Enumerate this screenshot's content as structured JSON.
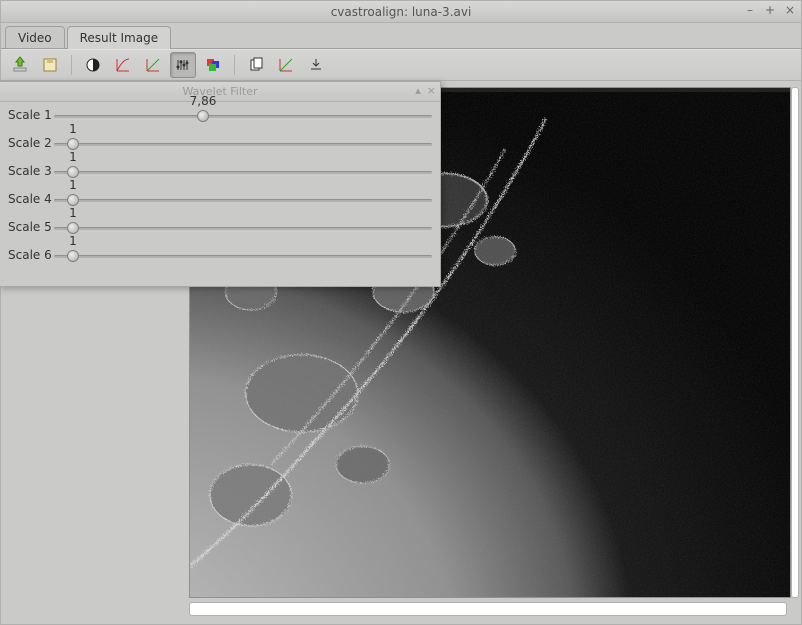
{
  "window": {
    "title": "cvastroalign: luna-3.avi"
  },
  "tabs": [
    {
      "label": "Video",
      "active": false
    },
    {
      "label": "Result Image",
      "active": true
    }
  ],
  "toolbar": {
    "icons": [
      "open-icon",
      "save-icon",
      "contrast-icon",
      "red-curve-icon",
      "green-curve-icon",
      "levels-icon",
      "rgb-balance-icon",
      "copy-icon",
      "histogram-icon",
      "export-icon"
    ],
    "active_index": 5
  },
  "wavelet_dialog": {
    "title": "Wavelet Filter",
    "scales": [
      {
        "label": "Scale 1",
        "value_text": "7,86",
        "value": 7.86,
        "min": 0,
        "max": 20
      },
      {
        "label": "Scale 2",
        "value_text": "1",
        "value": 1,
        "min": 0,
        "max": 20
      },
      {
        "label": "Scale 3",
        "value_text": "1",
        "value": 1,
        "min": 0,
        "max": 20
      },
      {
        "label": "Scale 4",
        "value_text": "1",
        "value": 1,
        "min": 0,
        "max": 20
      },
      {
        "label": "Scale 5",
        "value_text": "1",
        "value": 1,
        "min": 0,
        "max": 20
      },
      {
        "label": "Scale 6",
        "value_text": "1",
        "value": 1,
        "min": 0,
        "max": 20
      }
    ]
  }
}
